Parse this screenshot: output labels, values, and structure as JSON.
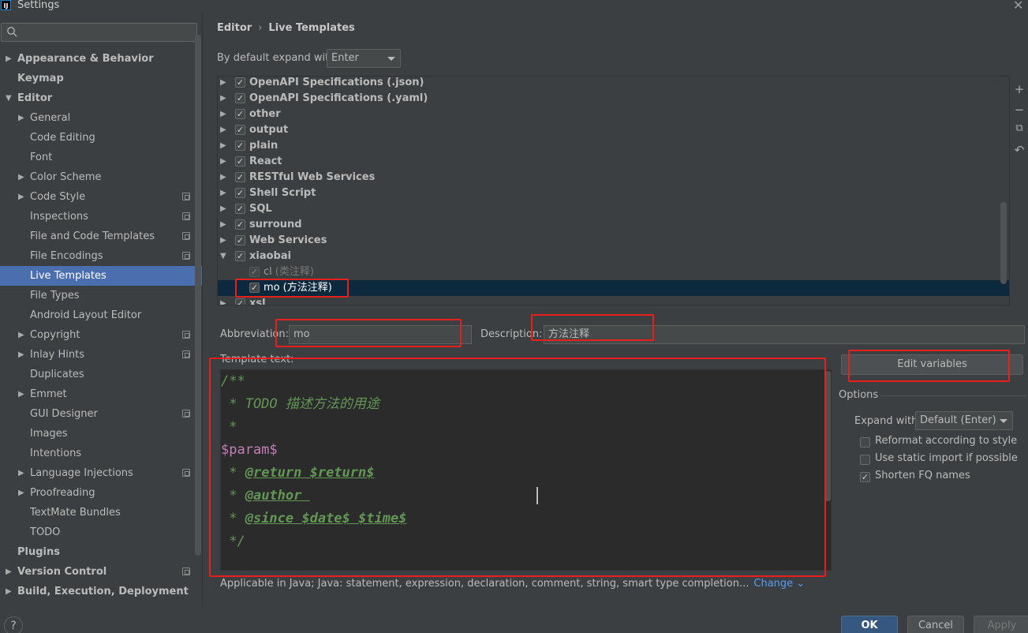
{
  "window": {
    "title": "Settings",
    "logo": "IJ"
  },
  "sidebar": {
    "search_placeholder": "",
    "items": [
      {
        "label": "Appearance & Behavior",
        "bold": true,
        "arrow": "right",
        "level": 0
      },
      {
        "label": "Keymap",
        "bold": true,
        "level": 0
      },
      {
        "label": "Editor",
        "bold": true,
        "arrow": "down",
        "level": 0
      },
      {
        "label": "General",
        "arrow": "right",
        "level": 1
      },
      {
        "label": "Code Editing",
        "level": 1
      },
      {
        "label": "Font",
        "level": 1
      },
      {
        "label": "Color Scheme",
        "arrow": "right",
        "level": 1
      },
      {
        "label": "Code Style",
        "arrow": "right",
        "level": 1,
        "project_icon": true
      },
      {
        "label": "Inspections",
        "level": 1,
        "project_icon": true
      },
      {
        "label": "File and Code Templates",
        "level": 1,
        "project_icon": true
      },
      {
        "label": "File Encodings",
        "level": 1,
        "project_icon": true
      },
      {
        "label": "Live Templates",
        "level": 1,
        "selected": true
      },
      {
        "label": "File Types",
        "level": 1
      },
      {
        "label": "Android Layout Editor",
        "level": 1
      },
      {
        "label": "Copyright",
        "arrow": "right",
        "level": 1,
        "project_icon": true
      },
      {
        "label": "Inlay Hints",
        "arrow": "right",
        "level": 1,
        "project_icon": true
      },
      {
        "label": "Duplicates",
        "level": 1
      },
      {
        "label": "Emmet",
        "arrow": "right",
        "level": 1
      },
      {
        "label": "GUI Designer",
        "level": 1,
        "project_icon": true
      },
      {
        "label": "Images",
        "level": 1
      },
      {
        "label": "Intentions",
        "level": 1
      },
      {
        "label": "Language Injections",
        "arrow": "right",
        "level": 1,
        "project_icon": true
      },
      {
        "label": "Proofreading",
        "arrow": "right",
        "level": 1
      },
      {
        "label": "TextMate Bundles",
        "level": 1
      },
      {
        "label": "TODO",
        "level": 1
      },
      {
        "label": "Plugins",
        "bold": true,
        "level": 0
      },
      {
        "label": "Version Control",
        "bold": true,
        "arrow": "right",
        "level": 0,
        "project_icon": true
      },
      {
        "label": "Build, Execution, Deployment",
        "bold": true,
        "arrow": "right",
        "level": 0
      }
    ]
  },
  "breadcrumb": {
    "parent": "Editor",
    "current": "Live Templates",
    "sep": "›"
  },
  "expand_default": {
    "label": "By default expand with",
    "value": "Enter"
  },
  "template_groups": [
    {
      "label": "OpenAPI Specifications (.json)"
    },
    {
      "label": "OpenAPI Specifications (.yaml)"
    },
    {
      "label": "other"
    },
    {
      "label": "output"
    },
    {
      "label": "plain"
    },
    {
      "label": "React"
    },
    {
      "label": "RESTful Web Services"
    },
    {
      "label": "Shell Script"
    },
    {
      "label": "SQL"
    },
    {
      "label": "surround"
    },
    {
      "label": "Web Services"
    },
    {
      "label": "xiaobai",
      "expanded": true
    },
    {
      "label": "cl",
      "desc": "(类注释)",
      "child": true
    },
    {
      "label": "mo",
      "desc": "(方法注释)",
      "child": true,
      "selected": true
    },
    {
      "label": "xsl"
    }
  ],
  "tree_tools": {
    "add": "+",
    "remove": "−",
    "copy": "⧉",
    "restore": "↶"
  },
  "abbreviation": {
    "label": "Abbreviation:",
    "value": "mo"
  },
  "description": {
    "label": "Description:",
    "value": "方法注释"
  },
  "template_text": {
    "label": "Template text:",
    "lines": [
      "/**",
      " * TODO 描述方法的用途",
      " *",
      "$param$",
      " * @return $return$",
      " * @author ",
      " * @since $date$ $time$",
      " */"
    ]
  },
  "applicable": {
    "text": "Applicable in Java; Java: statement, expression, declaration, comment, string, smart type completion...",
    "link": "Change"
  },
  "edit_variables": {
    "label": "Edit variables"
  },
  "options": {
    "title": "Options",
    "expand_with_label": "Expand with",
    "expand_with_value": "Default (Enter)",
    "checkboxes": [
      {
        "label": "Reformat according to style",
        "checked": false
      },
      {
        "label": "Use static import if possible",
        "checked": false
      },
      {
        "label": "Shorten FQ names",
        "checked": true
      }
    ]
  },
  "footer": {
    "help": "?",
    "ok": "OK",
    "cancel": "Cancel",
    "apply": "Apply"
  },
  "colors": {
    "accent": "#4b6eaf",
    "annotation": "#e8201c",
    "selected_row": "#0d293e"
  }
}
